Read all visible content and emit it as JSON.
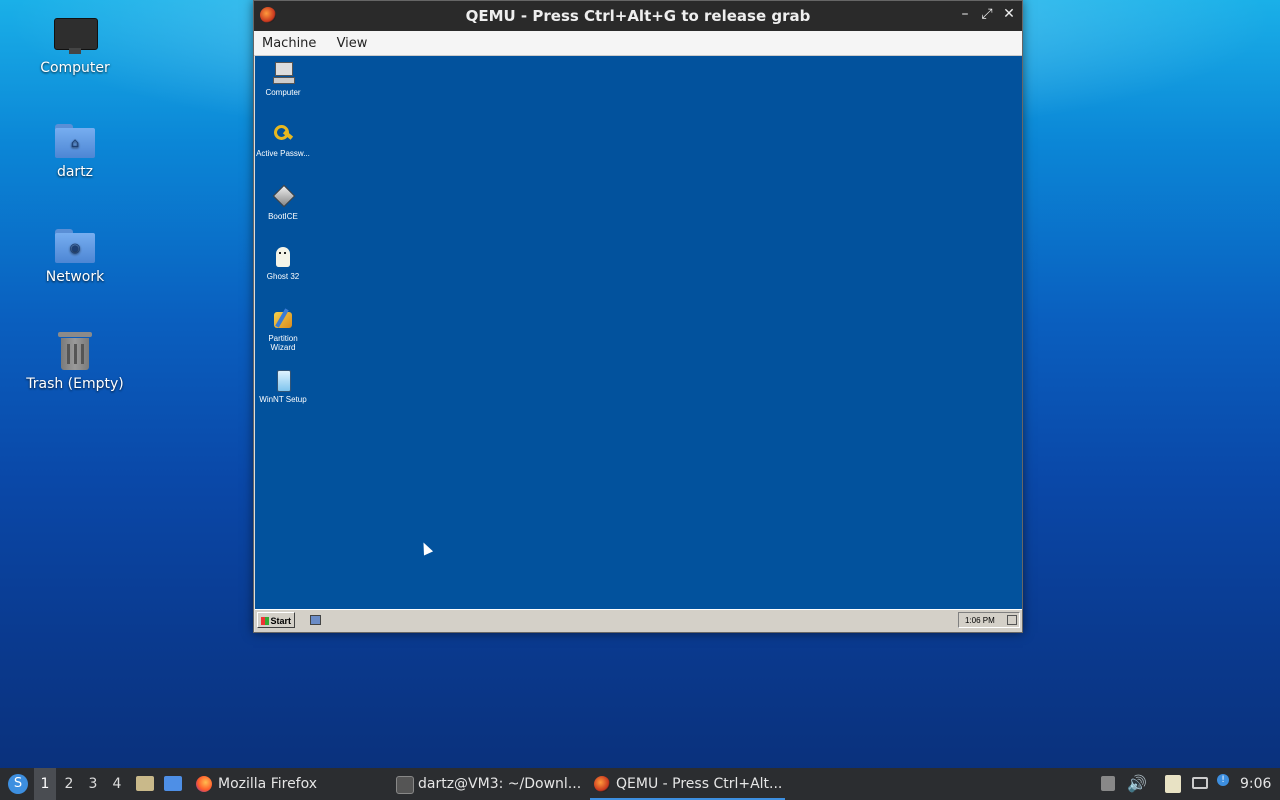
{
  "desktop": {
    "icons": [
      {
        "label": "Computer",
        "icon": "monitor-icon"
      },
      {
        "label": "dartz",
        "icon": "home-folder-icon"
      },
      {
        "label": "Network",
        "icon": "network-folder-icon"
      },
      {
        "label": "Trash (Empty)",
        "icon": "trash-icon"
      }
    ]
  },
  "qemu": {
    "title": "QEMU - Press Ctrl+Alt+G to release grab",
    "menu": [
      "Machine",
      "View"
    ],
    "controls": {
      "minimize": "–",
      "maximize": "⤢",
      "close": "✕"
    },
    "guest": {
      "background": "#02529d",
      "icons": [
        {
          "label": "Computer",
          "icon": "computer-icon"
        },
        {
          "label": "Active Passw...",
          "icon": "key-icon"
        },
        {
          "label": "BootICE",
          "icon": "bootice-icon"
        },
        {
          "label": "Ghost 32",
          "icon": "ghost-icon"
        },
        {
          "label": "Partition Wizard",
          "icon": "partition-wizard-icon"
        },
        {
          "label": "WinNT Setup",
          "icon": "winnt-setup-icon"
        }
      ],
      "taskbar": {
        "start_label": "Start",
        "clock": "1:06 PM"
      }
    }
  },
  "taskbar": {
    "workspaces": [
      "1",
      "2",
      "3",
      "4"
    ],
    "active_workspace": "1",
    "windows": [
      {
        "label": "Mozilla Firefox",
        "icon": "firefox-icon"
      },
      {
        "label": "dartz@VM3: ~/Downl...",
        "icon": "terminal-icon"
      },
      {
        "label": "QEMU - Press Ctrl+Alt...",
        "icon": "qemu-icon",
        "active": true
      }
    ],
    "clock": "9:06",
    "accent": "#3d8fe0"
  }
}
